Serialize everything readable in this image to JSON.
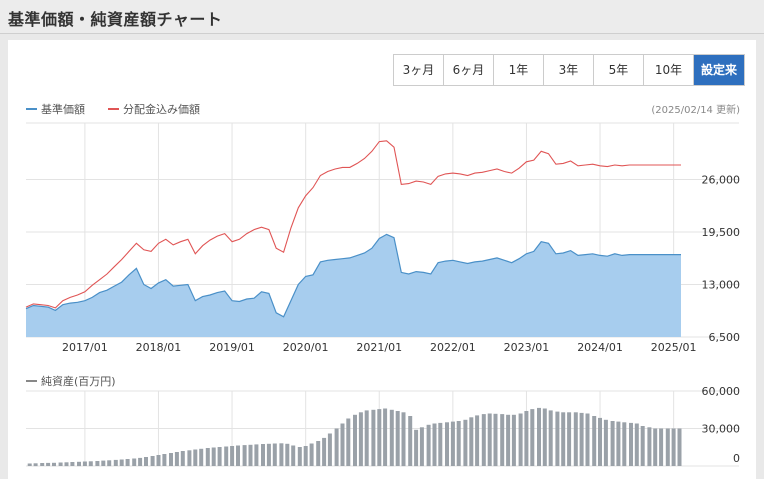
{
  "header": {
    "title": "基準価額・純資産額チャート"
  },
  "range_buttons": [
    {
      "label": "3ヶ月",
      "active": false
    },
    {
      "label": "6ヶ月",
      "active": false
    },
    {
      "label": "1年",
      "active": false
    },
    {
      "label": "3年",
      "active": false
    },
    {
      "label": "5年",
      "active": false
    },
    {
      "label": "10年",
      "active": false
    },
    {
      "label": "設定来",
      "active": true
    }
  ],
  "colors": {
    "nav": "#4a90c8",
    "nav_fill": "#a7cdee",
    "dist": "#e05555",
    "assets": "#9aa1a8",
    "active": "#2e6fbe"
  },
  "chart_data": [
    {
      "type": "area",
      "legend": [
        {
          "name": "基準価額",
          "color": "#4a90c8"
        },
        {
          "name": "分配金込み価額",
          "color": "#e05555"
        }
      ],
      "legend_position": "top-left",
      "update_note": "(2025/02/14 更新)",
      "x_tick_labels": [
        "2017/01",
        "2018/01",
        "2019/01",
        "2020/01",
        "2021/01",
        "2022/01",
        "2023/01",
        "2024/01",
        "2025/01"
      ],
      "y_tick_labels": [
        "6,500",
        "13,000",
        "19,500",
        "26,000"
      ],
      "ylim": [
        6500,
        33000
      ],
      "grid": true,
      "x_range": [
        2016.2,
        2025.1
      ],
      "series": [
        {
          "name": "基準価額",
          "x": [
            2016.2,
            2016.3,
            2016.4,
            2016.5,
            2016.6,
            2016.7,
            2016.8,
            2016.9,
            2017.0,
            2017.1,
            2017.2,
            2017.3,
            2017.4,
            2017.5,
            2017.6,
            2017.7,
            2017.8,
            2017.9,
            2018.0,
            2018.1,
            2018.2,
            2018.3,
            2018.4,
            2018.5,
            2018.6,
            2018.7,
            2018.8,
            2018.9,
            2019.0,
            2019.1,
            2019.2,
            2019.3,
            2019.4,
            2019.5,
            2019.6,
            2019.7,
            2019.8,
            2019.9,
            2020.0,
            2020.1,
            2020.2,
            2020.3,
            2020.4,
            2020.5,
            2020.6,
            2020.7,
            2020.8,
            2020.9,
            2021.0,
            2021.1,
            2021.2,
            2021.3,
            2021.4,
            2021.5,
            2021.6,
            2021.7,
            2021.8,
            2021.9,
            2022.0,
            2022.1,
            2022.2,
            2022.3,
            2022.4,
            2022.5,
            2022.6,
            2022.7,
            2022.8,
            2022.9,
            2023.0,
            2023.1,
            2023.2,
            2023.3,
            2023.4,
            2023.5,
            2023.6,
            2023.7,
            2023.8,
            2023.9,
            2024.0,
            2024.1,
            2024.2,
            2024.3,
            2024.4,
            2024.5,
            2024.6,
            2024.7,
            2024.8,
            2024.9,
            2025.0,
            2025.1
          ],
          "y": [
            10000,
            10400,
            10300,
            10200,
            9800,
            10500,
            10700,
            10800,
            11000,
            11400,
            12000,
            12300,
            12800,
            13300,
            14200,
            15000,
            13000,
            12500,
            13200,
            13600,
            12800,
            12900,
            13000,
            11000,
            11500,
            11700,
            12000,
            12200,
            11000,
            10900,
            11200,
            11300,
            12100,
            11900,
            9500,
            9000,
            11000,
            13000,
            14000,
            14200,
            15800,
            16000,
            16100,
            16200,
            16300,
            16600,
            16900,
            17500,
            18700,
            19200,
            18800,
            14500,
            14300,
            14600,
            14500,
            14300,
            15700,
            15900,
            16000,
            15800,
            15600,
            15800,
            15900,
            16100,
            16300,
            16000,
            15700,
            16200,
            16800,
            17100,
            18300,
            18100,
            16800,
            16900,
            17200,
            16600,
            16700,
            16800,
            16600,
            16500,
            16800,
            16600,
            16700,
            16700,
            16700,
            16700,
            16700,
            16700,
            16700,
            16700
          ],
          "values_note": "approximate, read from chart"
        },
        {
          "name": "分配金込み価額",
          "x": [
            2016.2,
            2016.3,
            2016.4,
            2016.5,
            2016.6,
            2016.7,
            2016.8,
            2016.9,
            2017.0,
            2017.1,
            2017.2,
            2017.3,
            2017.4,
            2017.5,
            2017.6,
            2017.7,
            2017.8,
            2017.9,
            2018.0,
            2018.1,
            2018.2,
            2018.3,
            2018.4,
            2018.5,
            2018.6,
            2018.7,
            2018.8,
            2018.9,
            2019.0,
            2019.1,
            2019.2,
            2019.3,
            2019.4,
            2019.5,
            2019.6,
            2019.7,
            2019.8,
            2019.9,
            2020.0,
            2020.1,
            2020.2,
            2020.3,
            2020.4,
            2020.5,
            2020.6,
            2020.7,
            2020.8,
            2020.9,
            2021.0,
            2021.1,
            2021.2,
            2021.3,
            2021.4,
            2021.5,
            2021.6,
            2021.7,
            2021.8,
            2021.9,
            2022.0,
            2022.1,
            2022.2,
            2022.3,
            2022.4,
            2022.5,
            2022.6,
            2022.7,
            2022.8,
            2022.9,
            2023.0,
            2023.1,
            2023.2,
            2023.3,
            2023.4,
            2023.5,
            2023.6,
            2023.7,
            2023.8,
            2023.9,
            2024.0,
            2024.1,
            2024.2,
            2024.3,
            2024.4,
            2024.5,
            2024.6,
            2024.7,
            2024.8,
            2024.9,
            2025.0,
            2025.1
          ],
          "y": [
            10200,
            10600,
            10500,
            10400,
            10100,
            11000,
            11400,
            11700,
            12100,
            12900,
            13600,
            14300,
            15200,
            16100,
            17100,
            18100,
            17300,
            17100,
            18100,
            18600,
            17900,
            18300,
            18600,
            16800,
            17800,
            18500,
            19000,
            19300,
            18300,
            18600,
            19300,
            19800,
            20100,
            19800,
            17500,
            17000,
            20000,
            22500,
            24000,
            25000,
            26500,
            27000,
            27300,
            27500,
            27500,
            28000,
            28600,
            29500,
            30700,
            30800,
            30000,
            25400,
            25500,
            25800,
            25700,
            25400,
            26400,
            26700,
            26800,
            26700,
            26500,
            26800,
            26900,
            27100,
            27300,
            27000,
            26800,
            27400,
            28200,
            28400,
            29500,
            29200,
            27900,
            28000,
            28300,
            27700,
            27800,
            27900,
            27700,
            27600,
            27800,
            27700,
            27800,
            27800,
            27800,
            27800,
            27800,
            27800,
            27800,
            27800
          ]
        }
      ]
    },
    {
      "type": "bar",
      "legend": [
        {
          "name": "純資産(百万円)",
          "color": "#9aa1a8"
        }
      ],
      "legend_position": "top-left",
      "y_tick_labels": [
        "0",
        "30,000",
        "60,000"
      ],
      "ylim": [
        0,
        60000
      ],
      "x_range": [
        2016.2,
        2025.1
      ],
      "series": [
        {
          "name": "純資産(百万円)",
          "x": [
            2016.25,
            2016.33,
            2016.42,
            2016.5,
            2016.58,
            2016.67,
            2016.75,
            2016.83,
            2016.92,
            2017.0,
            2017.08,
            2017.17,
            2017.25,
            2017.33,
            2017.42,
            2017.5,
            2017.58,
            2017.67,
            2017.75,
            2017.83,
            2017.92,
            2018.0,
            2018.08,
            2018.17,
            2018.25,
            2018.33,
            2018.42,
            2018.5,
            2018.58,
            2018.67,
            2018.75,
            2018.83,
            2018.92,
            2019.0,
            2019.08,
            2019.17,
            2019.25,
            2019.33,
            2019.42,
            2019.5,
            2019.58,
            2019.67,
            2019.75,
            2019.83,
            2019.92,
            2020.0,
            2020.08,
            2020.17,
            2020.25,
            2020.33,
            2020.42,
            2020.5,
            2020.58,
            2020.67,
            2020.75,
            2020.83,
            2020.92,
            2021.0,
            2021.08,
            2021.17,
            2021.25,
            2021.33,
            2021.42,
            2021.5,
            2021.58,
            2021.67,
            2021.75,
            2021.83,
            2021.92,
            2022.0,
            2022.08,
            2022.17,
            2022.25,
            2022.33,
            2022.42,
            2022.5,
            2022.58,
            2022.67,
            2022.75,
            2022.83,
            2022.92,
            2023.0,
            2023.08,
            2023.17,
            2023.25,
            2023.33,
            2023.42,
            2023.5,
            2023.58,
            2023.67,
            2023.75,
            2023.83,
            2023.92,
            2024.0,
            2024.08,
            2024.17,
            2024.25,
            2024.33,
            2024.42,
            2024.5,
            2024.58,
            2024.67,
            2024.75,
            2024.83,
            2024.92,
            2025.0,
            2025.08
          ],
          "y": [
            2000,
            2200,
            2400,
            2500,
            2600,
            2800,
            3000,
            3200,
            3400,
            3600,
            3800,
            4000,
            4300,
            4600,
            4900,
            5200,
            5600,
            6000,
            6500,
            7200,
            8000,
            8800,
            9600,
            10400,
            11200,
            12000,
            12600,
            13200,
            13800,
            14400,
            14800,
            15200,
            15600,
            16000,
            16400,
            16700,
            17000,
            17300,
            17600,
            17800,
            18000,
            18200,
            17800,
            16400,
            15200,
            16000,
            18000,
            20000,
            22500,
            26000,
            30000,
            34000,
            38000,
            41000,
            43000,
            44500,
            45000,
            45500,
            46000,
            45000,
            44000,
            43000,
            40000,
            29000,
            31000,
            33000,
            34000,
            34500,
            35000,
            35500,
            36000,
            37000,
            39000,
            40500,
            41500,
            42000,
            41800,
            41500,
            41000,
            41000,
            42000,
            44000,
            45500,
            46500,
            46000,
            44500,
            43500,
            43000,
            43000,
            43000,
            42500,
            42000,
            40000,
            38500,
            37000,
            36000,
            35500,
            35000,
            34500,
            34000,
            32000,
            31000,
            30000,
            30000,
            30000,
            30000,
            30000
          ]
        }
      ]
    }
  ]
}
